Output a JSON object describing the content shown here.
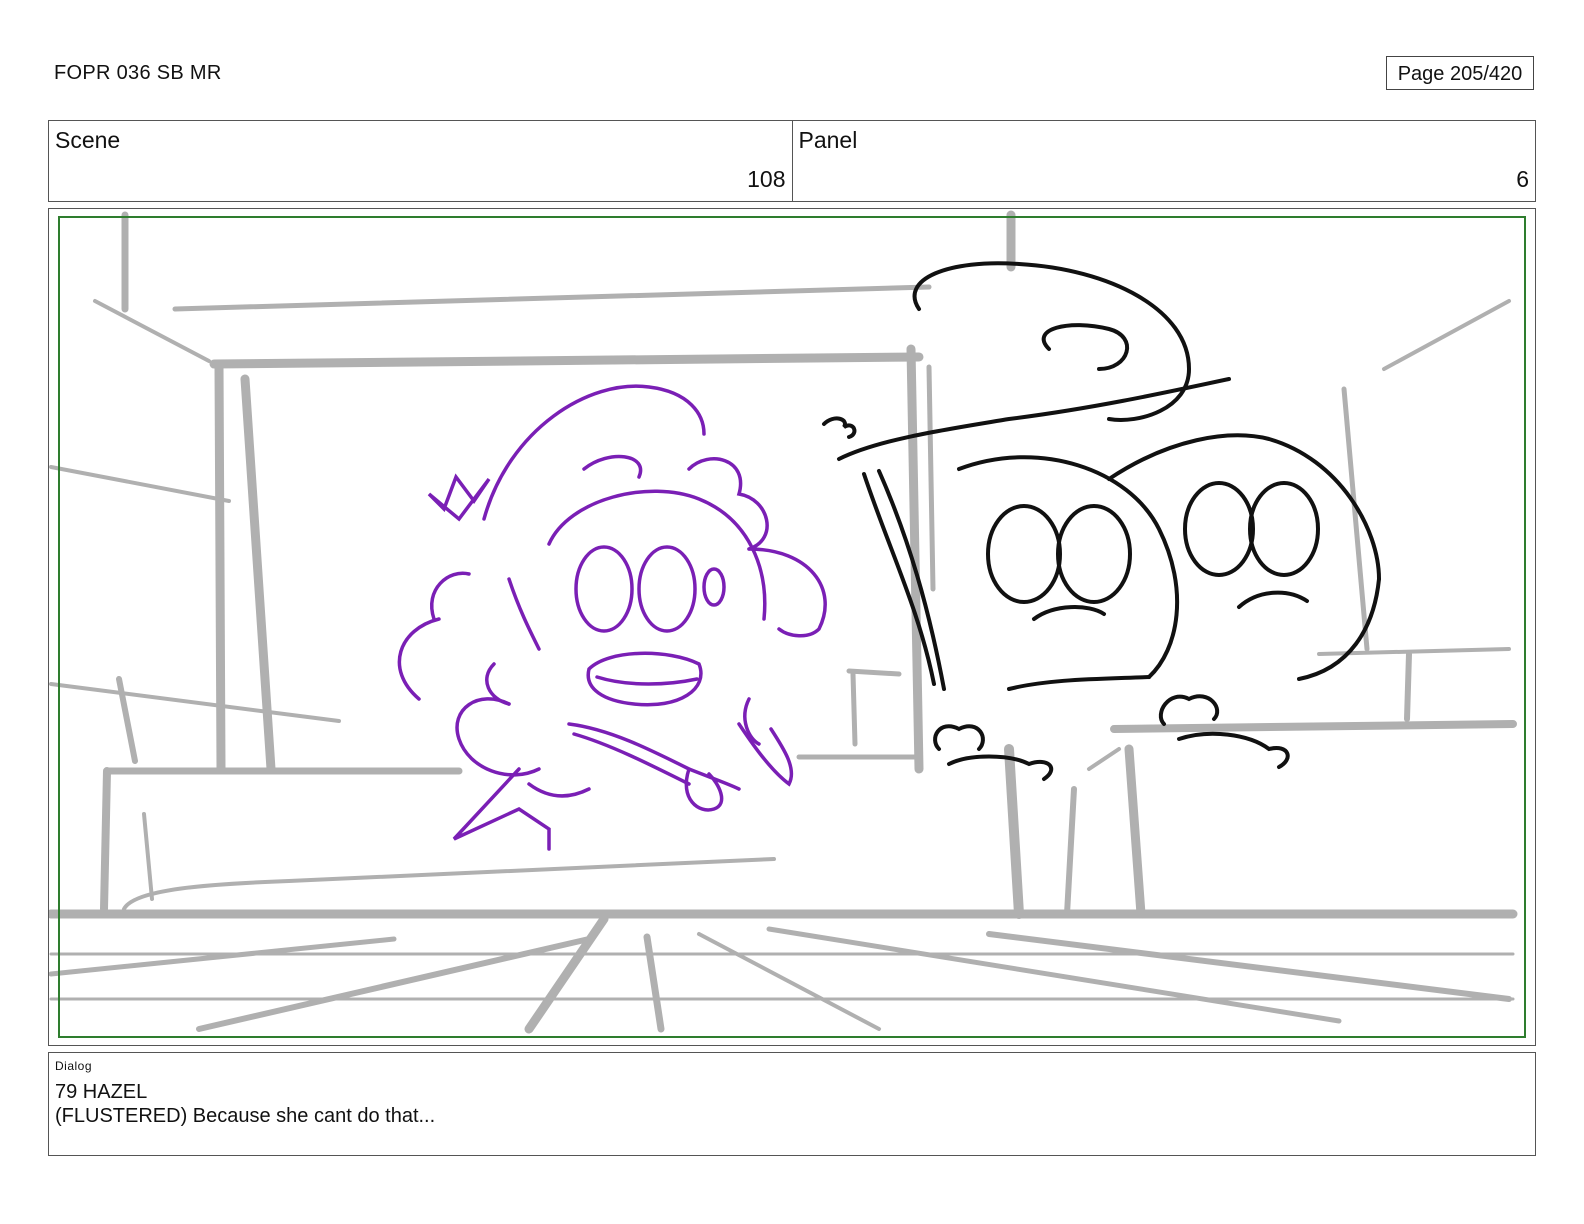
{
  "header": {
    "title": "FOPR 036 SB MR",
    "page_counter": "Page 205/420"
  },
  "scene": {
    "label": "Scene",
    "value": "108"
  },
  "panel": {
    "label": "Panel",
    "value": "6"
  },
  "artwork": {
    "description_icon": "storyboard-sketch",
    "colors": {
      "background_lines": "#b0b0b0",
      "character_left": "#7a1fb5",
      "characters_right": "#111111",
      "safe_frame": "#2e7d2e"
    }
  },
  "dialog": {
    "label": "Dialog",
    "lines": [
      "79 HAZEL",
      "(FLUSTERED) Because she cant do that..."
    ]
  }
}
